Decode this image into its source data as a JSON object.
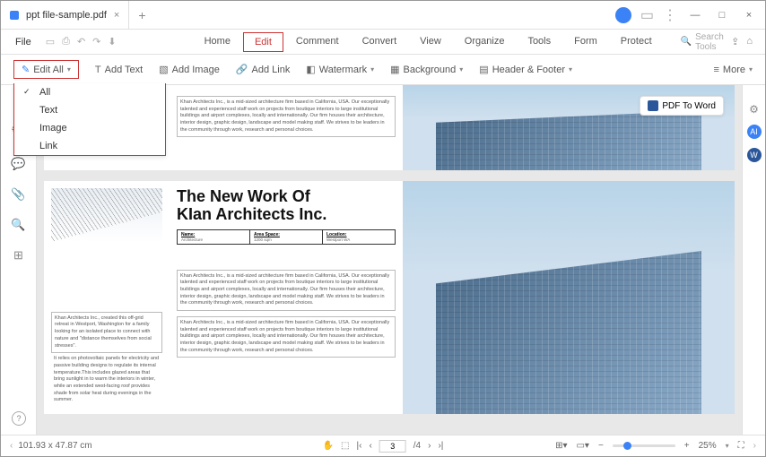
{
  "tab": {
    "title": "ppt file-sample.pdf"
  },
  "menu": {
    "file": "File",
    "tabs": [
      "Home",
      "Edit",
      "Comment",
      "Convert",
      "View",
      "Organize",
      "Tools",
      "Form",
      "Protect"
    ],
    "active_index": 1,
    "search_placeholder": "Search Tools"
  },
  "toolbar": {
    "edit_all": "Edit All",
    "add_text": "Add Text",
    "add_image": "Add Image",
    "add_link": "Add Link",
    "watermark": "Watermark",
    "background": "Background",
    "header_footer": "Header & Footer",
    "more": "More"
  },
  "dropdown": {
    "items": [
      "All",
      "Text",
      "Image",
      "Link"
    ],
    "checked_index": 0
  },
  "floating": {
    "pdf_to_word": "PDF To Word"
  },
  "doc": {
    "headline1": "The New Work Of",
    "headline2": "KIan Architects Inc.",
    "table": {
      "c1_label": "Name:",
      "c1_val": "Architecture",
      "c2_label": "Area Space:",
      "c2_val": "1200 sqm",
      "c3_label": "Location:",
      "c3_val": "Westport WA"
    },
    "para_short": "passive building designs internal temperature.This ed areas that bring warm the interiors in in extended west- vides shade from solar heat during evenings in the summer",
    "para_khan": "Khan Architects Inc., is a mid-sized architecture firm based in California, USA. Our exceptionally talented and experienced staff work on projects from boutique interiors to large institutional buildings and airport complexes, locally and internationally. Our firm houses their architecture, interior design, graphic design, landscape and model making staff. We strives to be leaders in the community through work, research and personal choices.",
    "para_left2a": "Khan Architects Inc., created this off-grid retreat in Westport, Washington for a family looking for an isolated place to connect with nature and \"distance themselves from social stresses\".",
    "para_left2b": "It relies on photovoltaic panels for electricity and passive building designs to regulate its internal temperature.This includes glazed areas that bring sunlight in to warm the interiors in winter, while an extended west-facing roof provides shade from solar heat during evenings in the summer."
  },
  "status": {
    "coords": "101.93 x 47.87 cm",
    "page_current": "3",
    "page_total": "/4",
    "zoom": "25%"
  }
}
